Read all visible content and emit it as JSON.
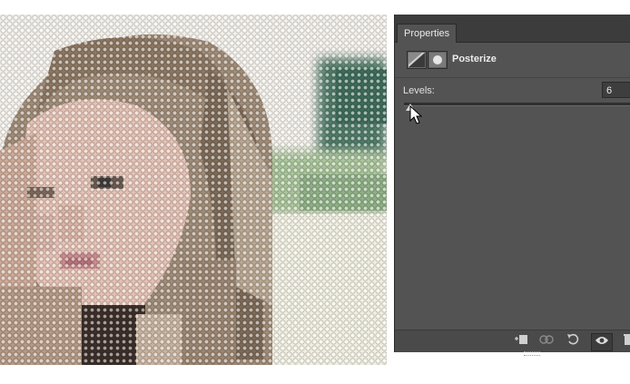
{
  "panel": {
    "tab_label": "Properties",
    "adjustment_title": "Posterize",
    "levels_label": "Levels:",
    "levels_value": "6",
    "icons": [
      "posterize-adjustment-icon",
      "layer-mask-icon"
    ]
  },
  "footer": {
    "buttons": [
      "clip-to-layer-icon",
      "view-previous-state-icon",
      "reset-icon",
      "visibility-eye-icon",
      "delete-trash-icon"
    ]
  },
  "colors": {
    "panel_bg": "#535353",
    "tabbar_bg": "#3c3c3c"
  }
}
